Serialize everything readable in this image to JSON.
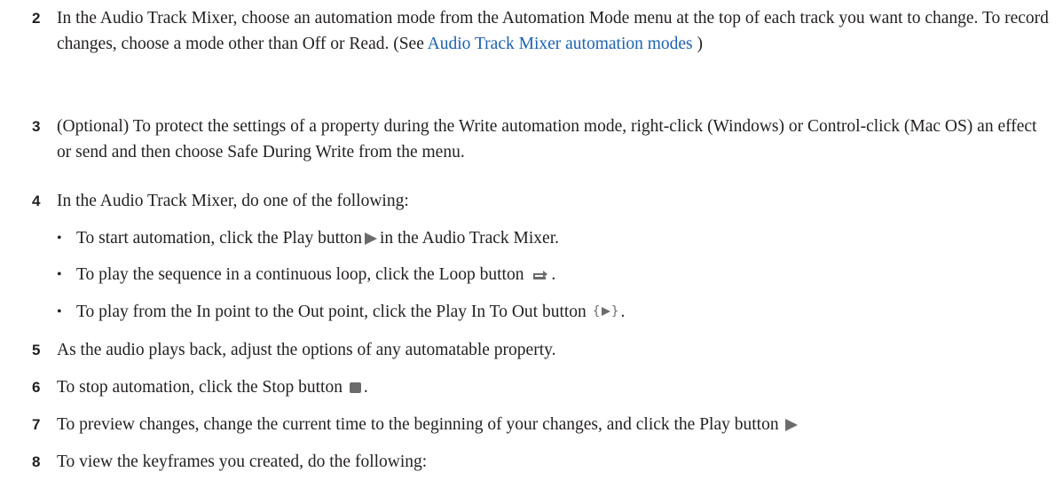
{
  "steps": [
    {
      "num": "2",
      "text_a": "In the Audio Track Mixer, choose an automation mode from the Automation Mode menu at the top of each track you want to change. To record changes, choose a mode other than Off or Read. (See ",
      "link": "Audio Track Mixer automation modes",
      "text_b": " )"
    },
    {
      "num": "3",
      "text": "(Optional) To protect the settings of a property during the Write automation mode, right-click (Windows) or Control-click (Mac OS) an effect or send and then choose Safe During Write from the menu."
    },
    {
      "num": "4",
      "text": "In the Audio Track Mixer, do one of the following:"
    },
    {
      "num": "5",
      "text": "As the audio plays back, adjust the options of any automatable property."
    },
    {
      "num": "6",
      "text_a": "To stop automation, click the Stop button",
      "text_b": "."
    },
    {
      "num": "7",
      "text_a": "To preview changes, change the current time to the beginning of your changes, and click the Play button"
    },
    {
      "num": "8",
      "text": "To view the keyframes you created, do the following:"
    }
  ],
  "bullets": [
    {
      "dot": "•",
      "text_a": "To start automation, click the Play button",
      "text_b": "in the Audio Track Mixer."
    },
    {
      "dot": "•",
      "text_a": "To play the sequence in a continuous loop, click the Loop button",
      "text_b": "."
    },
    {
      "dot": "•",
      "text_a": "To play from the In point to the Out point, click the Play In To Out button",
      "text_b": ".",
      "brace_open": "{",
      "brace_close": "}"
    }
  ],
  "icons": {
    "play": "play-icon",
    "loop": "loop-icon",
    "play_in_to_out": "play-in-to-out-icon",
    "stop": "stop-icon",
    "color": "#6b6b6b"
  },
  "colors": {
    "text": "#231f20",
    "link": "#1b62b5"
  }
}
